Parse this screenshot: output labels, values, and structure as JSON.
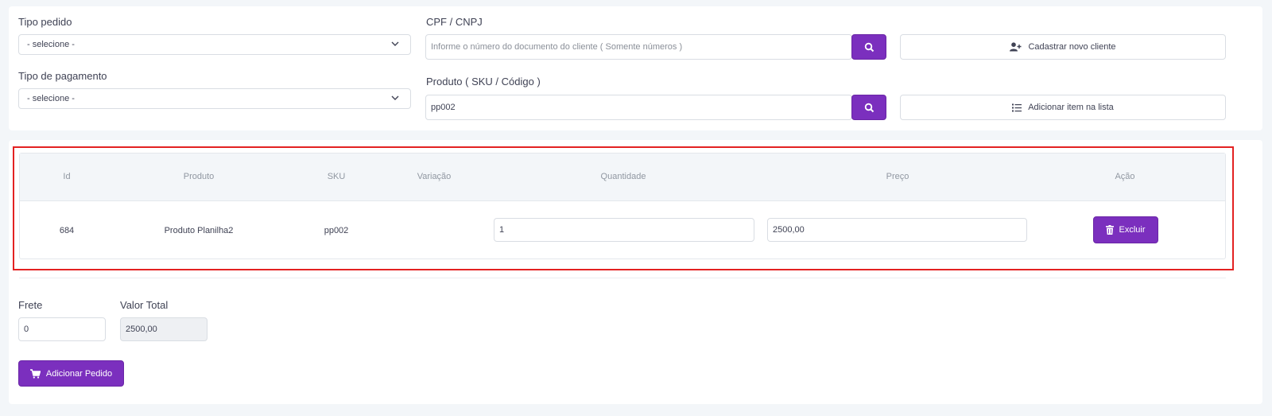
{
  "form": {
    "tipo_pedido": {
      "label": "Tipo pedido",
      "value": "- selecione -"
    },
    "tipo_pagamento": {
      "label": "Tipo de pagamento",
      "value": "- selecione -"
    },
    "cpf": {
      "label": "CPF / CNPJ",
      "placeholder": "Informe o número do documento do cliente ( Somente números )"
    },
    "produto": {
      "label": "Produto ( SKU / Código )",
      "value": "pp002"
    },
    "cadastrar_label": "Cadastrar novo cliente",
    "adicionar_item_label": "Adicionar item na lista"
  },
  "table": {
    "headers": [
      "Id",
      "Produto",
      "SKU",
      "Variação",
      "Quantidade",
      "Preço",
      "Ação"
    ],
    "rows": [
      {
        "id": "684",
        "produto": "Produto Planilha2",
        "sku": "pp002",
        "variacao": "",
        "quantidade": "1",
        "preco": "2500,00",
        "acao": "Excluir"
      }
    ]
  },
  "totals": {
    "frete_label": "Frete",
    "frete_value": "0",
    "valor_total_label": "Valor Total",
    "valor_total_value": "2500,00"
  },
  "submit_label": "Adicionar Pedido",
  "colors": {
    "primary": "#7b2fbe",
    "highlight": "#e32222",
    "background": "#f3f6f9"
  },
  "icons": [
    "chevron-down-icon",
    "search-icon",
    "user-plus-icon",
    "list-icon",
    "trash-icon",
    "cart-icon"
  ]
}
